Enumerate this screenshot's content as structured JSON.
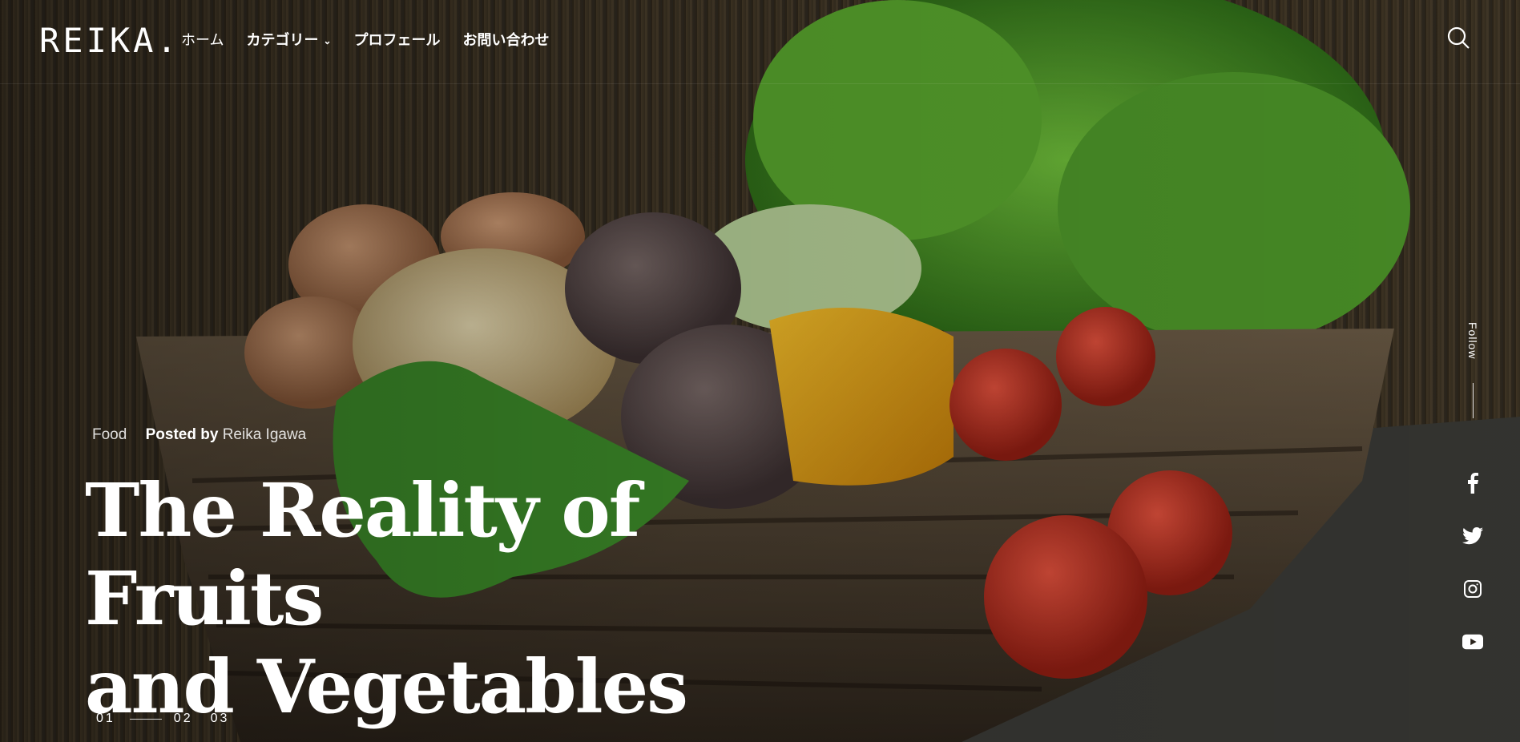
{
  "site": {
    "logo": "REIKA."
  },
  "nav": {
    "items": [
      {
        "label": "ホーム",
        "style": "light"
      },
      {
        "label": "カテゴリー",
        "has_dropdown": true
      },
      {
        "label": "プロフェール"
      },
      {
        "label": "お問い合わせ"
      }
    ],
    "search_icon": "search-icon"
  },
  "post": {
    "category": "Food",
    "posted_by_label": "Posted by",
    "author": "Reika Igawa",
    "title_line1": "The Reality of Fruits",
    "title_line2": "and Vegetables"
  },
  "pager": {
    "items": [
      "01",
      "02",
      "03"
    ],
    "active_index": 0
  },
  "follow": {
    "label": "Follow",
    "social_icons": [
      "facebook-icon",
      "twitter-icon",
      "instagram-icon",
      "youtube-icon"
    ]
  },
  "colors": {
    "text": "#ffffff",
    "overlay": "#000000"
  }
}
